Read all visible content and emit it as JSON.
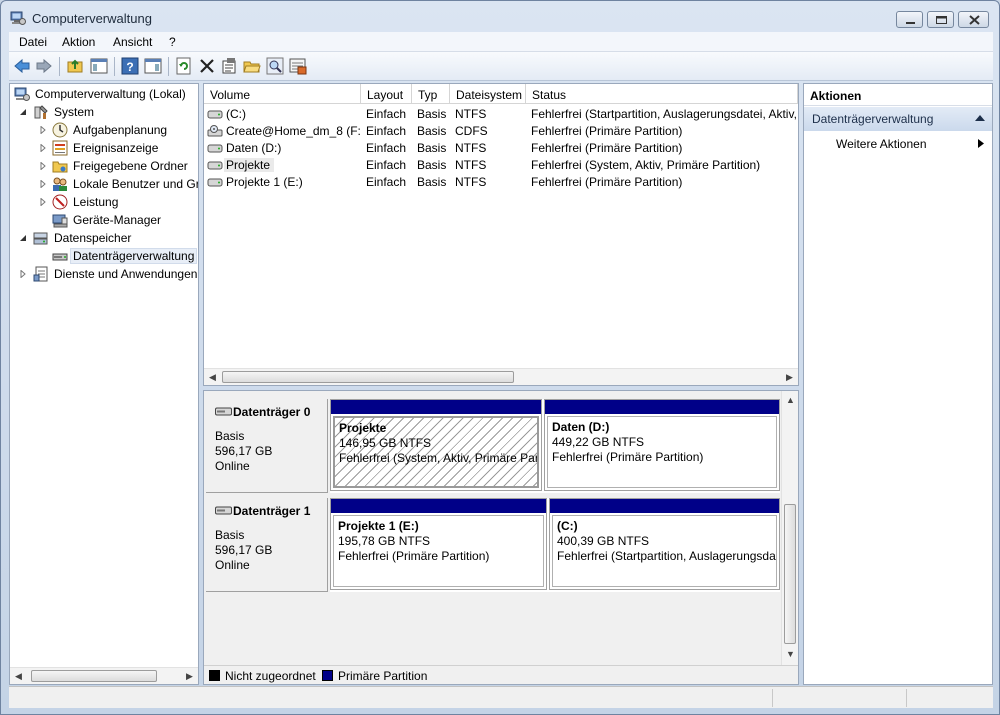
{
  "window": {
    "title": "Computerverwaltung"
  },
  "menu": [
    "Datei",
    "Aktion",
    "Ansicht",
    "?"
  ],
  "tree": {
    "root": "Computerverwaltung (Lokal)",
    "system": "System",
    "system_items": [
      "Aufgabenplanung",
      "Ereignisanzeige",
      "Freigegebene Ordner",
      "Lokale Benutzer und Gr",
      "Leistung",
      "Geräte-Manager"
    ],
    "storage": "Datenspeicher",
    "storage_items": [
      "Datenträgerverwaltung"
    ],
    "services": "Dienste und Anwendungen"
  },
  "volume_list": {
    "columns": [
      "Volume",
      "Layout",
      "Typ",
      "Dateisystem",
      "Status"
    ],
    "rows": [
      {
        "volume": "(C:)",
        "layout": "Einfach",
        "typ": "Basis",
        "fs": "NTFS",
        "status": "Fehlerfrei (Startpartition, Auslagerungsdatei, Aktiv,"
      },
      {
        "volume": "Create@Home_dm_8 (F:)",
        "layout": "Einfach",
        "typ": "Basis",
        "fs": "CDFS",
        "status": "Fehlerfrei (Primäre Partition)"
      },
      {
        "volume": "Daten (D:)",
        "layout": "Einfach",
        "typ": "Basis",
        "fs": "NTFS",
        "status": "Fehlerfrei (Primäre Partition)"
      },
      {
        "volume": "Projekte",
        "layout": "Einfach",
        "typ": "Basis",
        "fs": "NTFS",
        "status": "Fehlerfrei (System, Aktiv, Primäre Partition)"
      },
      {
        "volume": "Projekte 1 (E:)",
        "layout": "Einfach",
        "typ": "Basis",
        "fs": "NTFS",
        "status": "Fehlerfrei (Primäre Partition)"
      }
    ]
  },
  "disks": [
    {
      "name": "Datenträger 0",
      "type": "Basis",
      "size": "596,17 GB",
      "state": "Online",
      "partitions": [
        {
          "name": "Projekte",
          "size": "146,95 GB NTFS",
          "status": "Fehlerfrei (System, Aktiv, Primäre Part"
        },
        {
          "name": "Daten  (D:)",
          "size": "449,22 GB NTFS",
          "status": "Fehlerfrei (Primäre Partition)"
        }
      ]
    },
    {
      "name": "Datenträger 1",
      "type": "Basis",
      "size": "596,17 GB",
      "state": "Online",
      "partitions": [
        {
          "name": "Projekte 1  (E:)",
          "size": "195,78 GB NTFS",
          "status": "Fehlerfrei (Primäre Partition)"
        },
        {
          "name": "(C:)",
          "size": "400,39 GB NTFS",
          "status": "Fehlerfrei (Startpartition, Auslagerungsda"
        }
      ]
    }
  ],
  "legend": [
    "Nicht zugeordnet",
    "Primäre Partition"
  ],
  "colors": {
    "primary_partition": "#000088",
    "unallocated": "#000000"
  },
  "actions": {
    "header": "Aktionen",
    "section": "Datenträgerverwaltung",
    "items": [
      "Weitere Aktionen"
    ]
  }
}
